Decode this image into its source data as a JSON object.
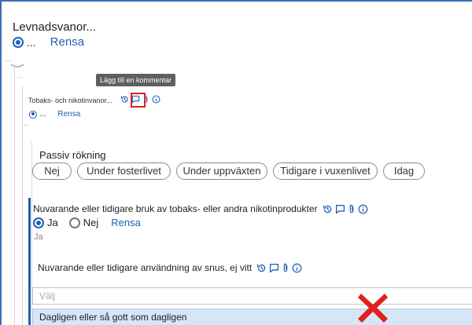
{
  "section": {
    "title": "Levnadsvanor...",
    "radio_text": "...",
    "clear_label": "Rensa",
    "ellipsis": "..."
  },
  "tooltip": {
    "text": "Lägg till en kommentar"
  },
  "tobacco_small": {
    "title": "Tobaks- och nikotinvanor...",
    "radio_text": "...",
    "clear_label": "Rensa",
    "ellipsis": "..."
  },
  "passive_smoking": {
    "label": "Passiv rökning",
    "options": [
      "Nej",
      "Under fosterlivet",
      "Under uppväxten",
      "Tidigare i vuxenlivet",
      "Idag"
    ]
  },
  "tobacco_use": {
    "question": "Nuvarande eller tidigare bruk av tobaks- eller andra nikotinprodukter",
    "yes_label": "Ja",
    "no_label": "Nej",
    "clear_label": "Rensa",
    "answer": "Ja"
  },
  "snus": {
    "question": "Nuvarande eller tidigare användning av snus, ej vitt",
    "placeholder": "Välj",
    "selected_option": "Dagligen eller så gott som dagligen"
  },
  "colors": {
    "accent": "#1f5fb5",
    "marker_red": "#e02020",
    "tooltip_bg": "#5f5f5f",
    "option_bg": "#d6e6f6"
  },
  "icons": [
    "history-icon",
    "comment-icon",
    "attachment-icon",
    "info-icon",
    "close-x-marker-icon"
  ]
}
